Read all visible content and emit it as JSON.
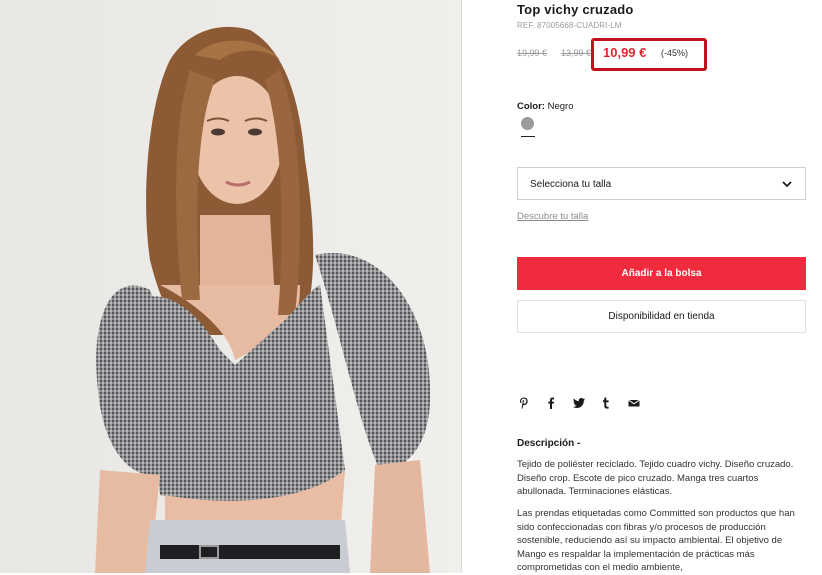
{
  "product": {
    "title": "Top vichy cruzado",
    "ref": "REF. 87005668-CUADRI-LM",
    "prices": {
      "original_1": "19,99 €",
      "original_2": "13,99 €",
      "current": "10,99 €",
      "discount": "(-45%)"
    },
    "color": {
      "label": "Color:",
      "value": "Negro",
      "swatch_color": "#9b9b9e"
    }
  },
  "actions": {
    "size_select_label": "Selecciona tu talla",
    "size_guide_link": "Descubre tu talla",
    "add_to_bag": "Añadir a la bolsa",
    "store_availability": "Disponibilidad en tienda"
  },
  "share": {
    "icons": [
      "pinterest-icon",
      "facebook-icon",
      "twitter-icon",
      "tumblr-icon",
      "email-icon"
    ]
  },
  "description": {
    "title": "Descripción -",
    "paragraph_1": "Tejido de poliéster reciclado. Tejido cuadro vichy. Diseño cruzado. Diseño crop. Escote de pico cruzado. Manga tres cuartos abullonada. Terminaciones elásticas.",
    "paragraph_2": "Las prendas etiquetadas como Committed son productos que han sido confeccionadas con fibras y/o procesos de producción sostenible, reduciendo así su impacto ambiental. El objetivo de Mango es respaldar la implementación de prácticas más comprometidas con el medio ambiente,"
  },
  "colors": {
    "accent_red": "#f02b3d",
    "price_red": "#e0262f",
    "highlight_box": "#c0121c"
  }
}
